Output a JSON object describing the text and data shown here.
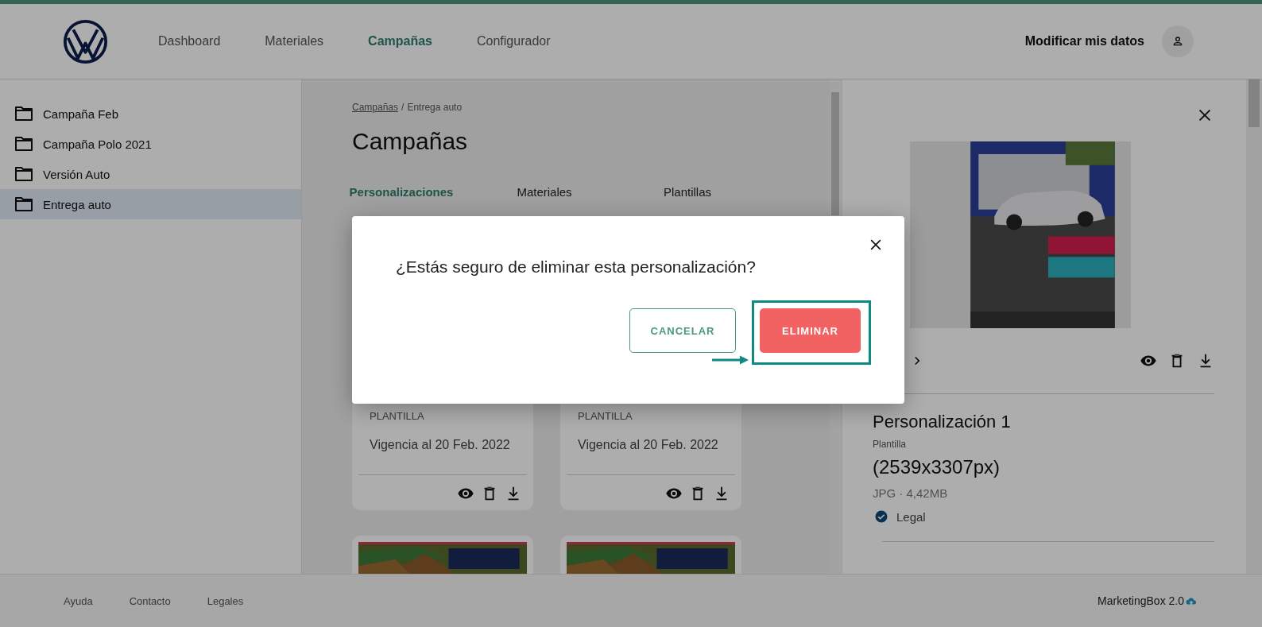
{
  "header": {
    "nav": [
      {
        "label": "Dashboard",
        "selected": false
      },
      {
        "label": "Materiales",
        "selected": false
      },
      {
        "label": "Campañas",
        "selected": true
      },
      {
        "label": "Configurador",
        "selected": false
      }
    ],
    "user_link": "Modificar mis datos"
  },
  "sidebar": {
    "folders": [
      {
        "label": "Campaña Feb",
        "selected": false
      },
      {
        "label": "Campaña Polo 2021",
        "selected": false
      },
      {
        "label": "Versión Auto",
        "selected": false
      },
      {
        "label": "Entrega auto",
        "selected": true
      }
    ]
  },
  "main": {
    "breadcrumb": {
      "link": "Campañas",
      "separator": "/",
      "current": "Entrega auto"
    },
    "title": "Campañas",
    "tabs": [
      {
        "label": "Personalizaciones",
        "selected": true
      },
      {
        "label": "Materiales",
        "selected": false
      },
      {
        "label": "Plantillas",
        "selected": false
      }
    ],
    "cards": [
      {
        "type_label": "PLANTILLA",
        "validity": "Vigencia al 20 Feb. 2022"
      },
      {
        "type_label": "PLANTILLA",
        "validity": "Vigencia al 20 Feb. 2022"
      }
    ]
  },
  "detail_panel": {
    "title": "Personalización 1",
    "subtitle": "Plantilla",
    "dimensions": "(2539x3307px)",
    "file_info": "JPG · 4,42MB",
    "legal": {
      "label": "Legal",
      "checked": true
    }
  },
  "dialog": {
    "message": "¿Estás seguro de eliminar esta personalización?",
    "buttons": [
      {
        "label": "CANCELAR",
        "kind": "secondary",
        "highlighted": false
      },
      {
        "label": "ELIMINAR",
        "kind": "danger",
        "highlighted": true
      }
    ]
  },
  "footer": {
    "links": [
      "Ayuda",
      "Contacto",
      "Legales"
    ],
    "brand": "MarketingBox 2.0"
  }
}
